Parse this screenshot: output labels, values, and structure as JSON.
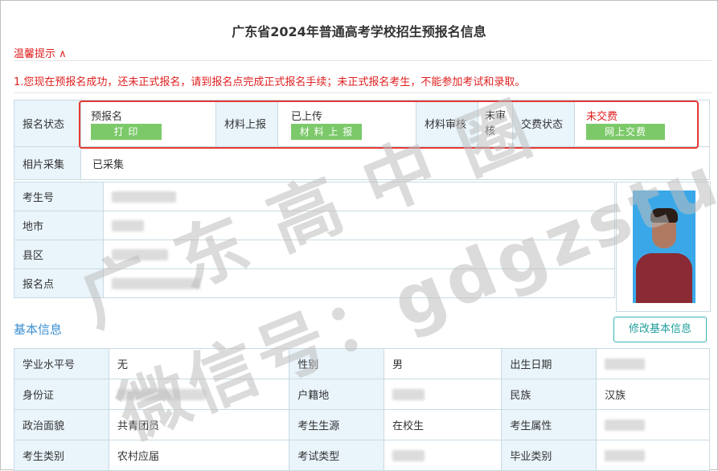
{
  "header": {
    "title": "广东省2024年普通高考学校招生预报名信息"
  },
  "tips": {
    "toggle_label": "温馨提示 ∧",
    "line1": "1.您现在预报名成功，还未正式报名，请到报名点完成正式报名手续；未正式报名考生，不能参加考试和录取。"
  },
  "status": {
    "row_label": "报名状态",
    "prereg_label": "预报名",
    "print_btn": "打 印",
    "material_label": "材料上报",
    "material_status": "已上传",
    "material_btn": "材 料 上 报",
    "review_label": "材料审核",
    "review_status": "未审核",
    "fee_label": "交费状态",
    "fee_status": "未交费",
    "fee_btn": "网上交费",
    "photo_label": "相片采集",
    "photo_status": "已采集"
  },
  "candidate": {
    "id_label": "考生号",
    "city_label": "地市",
    "county_label": "县区",
    "site_label": "报名点"
  },
  "basic": {
    "section_title": "基本信息",
    "edit_btn": "修改基本信息",
    "rows": [
      [
        {
          "l": "学业水平号",
          "v": "无"
        },
        {
          "l": "性别",
          "v": "男"
        },
        {
          "l": "出生日期",
          "v": ""
        }
      ],
      [
        {
          "l": "身份证",
          "v": ""
        },
        {
          "l": "户籍地",
          "v": ""
        },
        {
          "l": "民族",
          "v": "汉族"
        }
      ],
      [
        {
          "l": "政治面貌",
          "v": "共青团员"
        },
        {
          "l": "考生生源",
          "v": "在校生"
        },
        {
          "l": "考生属性",
          "v": ""
        }
      ],
      [
        {
          "l": "考生类别",
          "v": "农村应届"
        },
        {
          "l": "考试类型",
          "v": ""
        },
        {
          "l": "毕业类别",
          "v": ""
        }
      ]
    ]
  },
  "watermark": {
    "line1": "广东高中圈",
    "line2": "微信号：gdgzstu"
  },
  "colors": {
    "accent_blue": "#3b8fd2",
    "button_green": "#7cc96a",
    "alert_red": "#e02020",
    "label_bg": "#e9f4fb"
  }
}
